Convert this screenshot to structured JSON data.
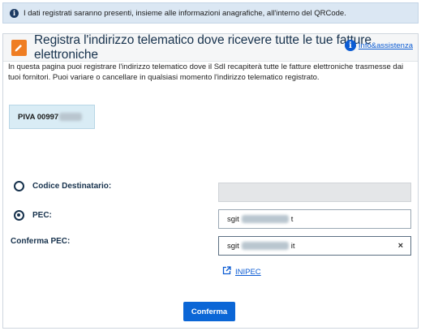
{
  "banner": {
    "text": "I dati registrati saranno presenti, insieme alle informazioni anagrafiche, all'interno del QRCode.",
    "icon": "info-icon"
  },
  "header": {
    "title": "Registra l'indirizzo telematico dove ricevere tutte le tue fatture elettroniche",
    "icon": "edit-icon",
    "accent": "#ef7d22"
  },
  "help": {
    "label": "Info&assistenza",
    "icon": "info-icon"
  },
  "description": "In questa pagina puoi registrare l'indirizzo telematico dove il SdI recapiterà tutte le fatture elettroniche trasmesse dai tuoi fornitori. Puoi variare o cancellare in qualsiasi momento l'indirizzo telematico registrato.",
  "piva": {
    "label": "PIVA 00997"
  },
  "form": {
    "codice_label": "Codice Destinatario:",
    "codice_selected": false,
    "pec_label": "PEC:",
    "pec_selected": true,
    "pec_value_start": "sgit",
    "pec_value_end": "t",
    "confirm_label": "Conferma PEC:",
    "confirm_value_start": "sgit",
    "confirm_value_end": "it",
    "clear_glyph": "×"
  },
  "inipec": {
    "label": "INIPEC",
    "icon": "external-link-icon"
  },
  "submit": {
    "label": "Conferma"
  },
  "colors": {
    "primary": "#0b66d6",
    "banner_bg": "#dbe7f3",
    "piva_bg": "#d9ecf5"
  }
}
